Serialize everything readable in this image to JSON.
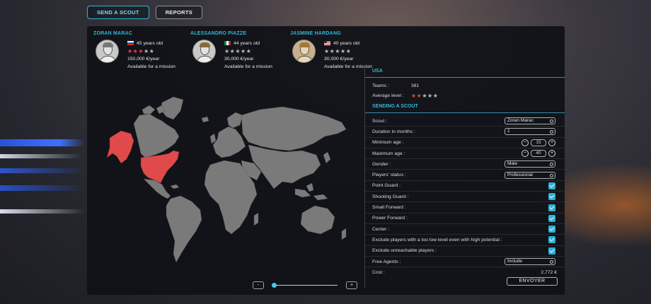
{
  "tabs": [
    {
      "label": "SEND A SCOUT",
      "active": true
    },
    {
      "label": "REPORTS",
      "active": false
    }
  ],
  "scouts": [
    {
      "name": "ZORAN MARAC",
      "age": "45 years old",
      "flag": "ru",
      "rating": 3,
      "salary": "150,000 €/year",
      "status": "Available for a mission"
    },
    {
      "name": "ALESSANDRO PIAZZE",
      "age": "44 years old",
      "flag": "it",
      "rating": 0,
      "salary": "30,000 €/year",
      "status": "Available for a mission"
    },
    {
      "name": "JASMINE HARDANG",
      "age": "40 years old",
      "flag": "us",
      "rating": 0,
      "salary": "30,000 €/year",
      "status": "Available for a mission"
    }
  ],
  "country": {
    "title": "USA",
    "teams_label": "Teams :",
    "teams_value": "381",
    "avg_label": "Average level :",
    "avg_rating": 2
  },
  "sending": {
    "title": "SENDING A SCOUT",
    "scout_label": "Scout :",
    "scout_value": "Zoran Marac",
    "duration_label": "Duration in months :",
    "duration_value": "1",
    "min_age_label": "Minimum age :",
    "min_age_value": "15",
    "max_age_label": "Maximum age :",
    "max_age_value": "40",
    "gender_label": "Gender :",
    "gender_value": "Male",
    "status_label": "Players' status :",
    "status_value": "Professional",
    "checks": [
      {
        "label": "Point Guard :",
        "checked": true
      },
      {
        "label": "Shooting Guard :",
        "checked": true
      },
      {
        "label": "Small Forward :",
        "checked": true
      },
      {
        "label": "Power Forward :",
        "checked": true
      },
      {
        "label": "Center :",
        "checked": true
      },
      {
        "label": "Exclude players with a too low level even with high potential :",
        "checked": true
      },
      {
        "label": "Exclude unreachable players :",
        "checked": true
      }
    ],
    "free_agents_label": "Free Agents :",
    "free_agents_value": "Include",
    "cost_label": "Cost :",
    "cost_value": "2,772 €",
    "send_label": "ENVOYER"
  },
  "zoom": {
    "minus": "-",
    "plus": "+",
    "level": 0.02
  },
  "map": {
    "highlight_color": "#e04a4a",
    "land_color": "#7a7a7a",
    "dark_land_color": "#5e5e5e",
    "highlighted": [
      "USA",
      "Alaska"
    ]
  },
  "colors": {
    "accent": "#35b6d8",
    "star_on": "#e24848",
    "star_off": "#b9bcc2"
  }
}
